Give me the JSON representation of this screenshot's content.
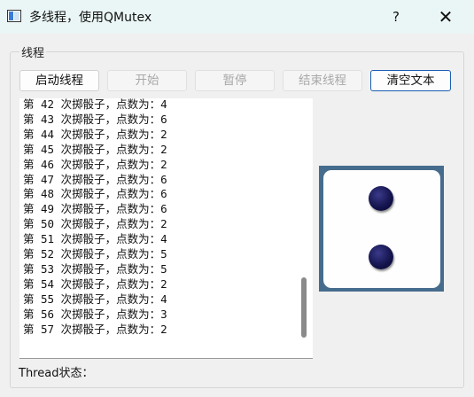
{
  "window": {
    "title": "多线程，使用QMutex",
    "help_label": "?",
    "close_label": "✕",
    "app_icon": "window-icon"
  },
  "group": {
    "title": "线程"
  },
  "buttons": {
    "start_thread": "启动线程",
    "begin": "开始",
    "pause": "暂停",
    "end_thread": "结束线程",
    "clear_text": "清空文本"
  },
  "log": {
    "lines": [
      "第 42 次掷骰子，点数为：4",
      "第 43 次掷骰子，点数为：6",
      "第 44 次掷骰子，点数为：2",
      "第 45 次掷骰子，点数为：2",
      "第 46 次掷骰子，点数为：2",
      "第 47 次掷骰子，点数为：6",
      "第 48 次掷骰子，点数为：6",
      "第 49 次掷骰子，点数为：6",
      "第 50 次掷骰子，点数为：2",
      "第 51 次掷骰子，点数为：4",
      "第 52 次掷骰子，点数为：5",
      "第 53 次掷骰子，点数为：5",
      "第 54 次掷骰子，点数为：2",
      "第 55 次掷骰子，点数为：4",
      "第 56 次掷骰子，点数为：3",
      "第 57 次掷骰子，点数为：2"
    ]
  },
  "dice": {
    "value": 2,
    "frame_color": "#466c8d",
    "pip_color": "#151550"
  },
  "status": {
    "label": "Thread状态："
  }
}
